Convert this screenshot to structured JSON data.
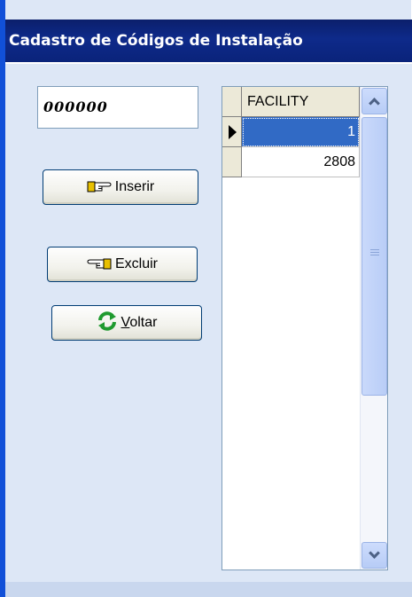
{
  "window": {
    "title": "Cadastro de Códigos de Instalação"
  },
  "form": {
    "code_value": "000000"
  },
  "buttons": {
    "inserir": {
      "label": "Inserir",
      "icon": "hand-pointing-right-icon"
    },
    "excluir": {
      "label": "Excluir",
      "icon": "hand-pointing-left-icon"
    },
    "voltar": {
      "label": "Voltar",
      "accel": "V",
      "rest": "oltar",
      "icon": "refresh-arrows-icon"
    }
  },
  "grid": {
    "columns": [
      "FACILITY"
    ],
    "rows": [
      {
        "facility": "1",
        "selected": true
      },
      {
        "facility": "2808",
        "selected": false
      }
    ]
  },
  "colors": {
    "titlebar": "#0e2a8a",
    "client_bg": "#dde7f6",
    "selection": "#316ac5",
    "button_border": "#003c74"
  }
}
